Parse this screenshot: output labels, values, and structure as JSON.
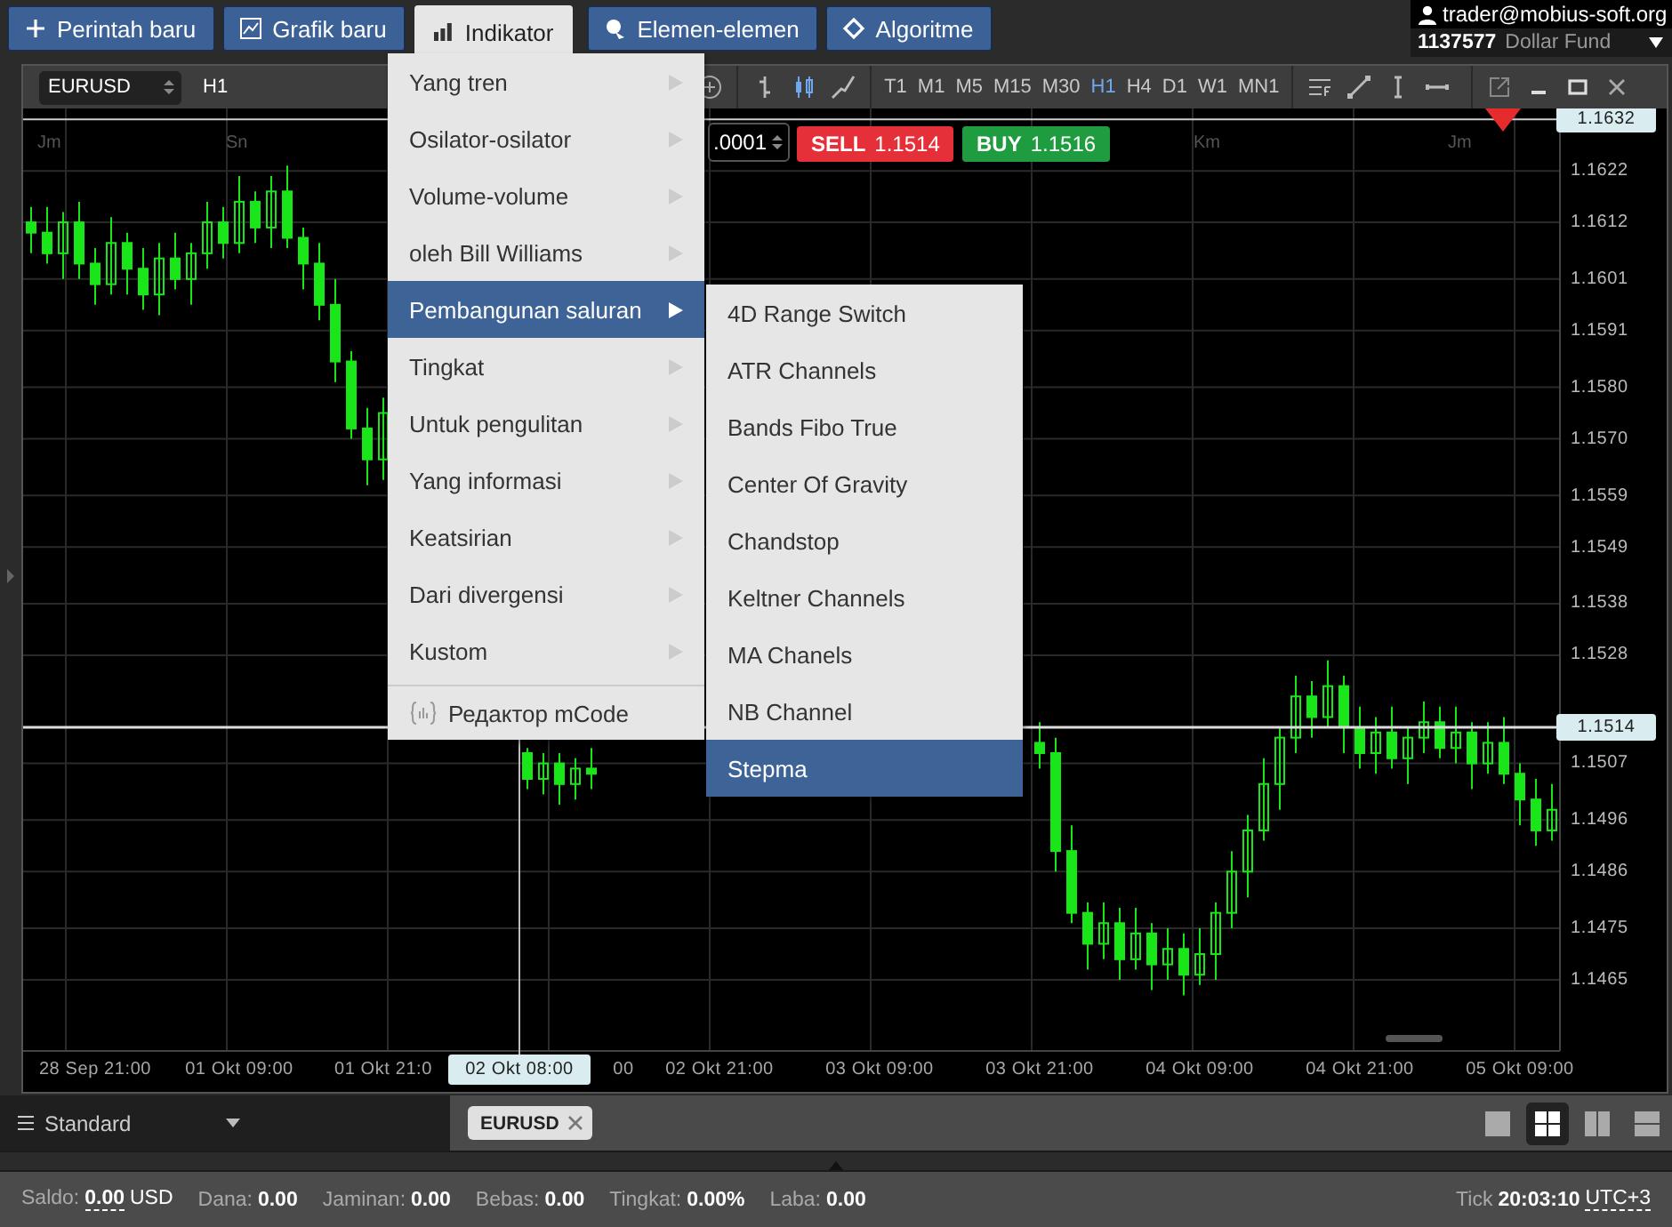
{
  "top_menu": [
    {
      "label": "Perintah baru",
      "selected": false
    },
    {
      "label": "Grafik baru",
      "selected": false
    },
    {
      "label": "Indikator",
      "selected": true
    },
    {
      "label": "Elemen-elemen",
      "selected": false
    },
    {
      "label": "Algoritme",
      "selected": false
    }
  ],
  "account": {
    "email": "trader@mobius-soft.org",
    "number": "1137577",
    "name": "Dollar Fund"
  },
  "chart": {
    "symbol": "EURUSD",
    "period": "H1",
    "lot": ".0001",
    "sell": {
      "label": "SELL",
      "price": "1.1514"
    },
    "buy": {
      "label": "BUY",
      "price": "1.1516"
    },
    "timeframes": [
      {
        "label": "T1",
        "selected": false
      },
      {
        "label": "M1",
        "selected": false
      },
      {
        "label": "M5",
        "selected": false
      },
      {
        "label": "M15",
        "selected": false
      },
      {
        "label": "M30",
        "selected": false
      },
      {
        "label": "H1",
        "selected": true
      },
      {
        "label": "H4",
        "selected": false
      },
      {
        "label": "D1",
        "selected": false
      },
      {
        "label": "W1",
        "selected": false
      },
      {
        "label": "MN1",
        "selected": false
      }
    ],
    "day_labels": [
      "Jm",
      "Sn",
      "Km",
      "Jm"
    ],
    "chart_data": {
      "type": "candlestick",
      "categories": [
        null,
        null,
        null,
        null,
        "28 Sep 21:00",
        null,
        null,
        null,
        null,
        null,
        null,
        null,
        null,
        "01 Okt 09:00",
        null,
        null,
        null,
        null,
        null,
        null,
        null,
        null,
        "01 Okt 21:0",
        null,
        null,
        null,
        null,
        null,
        null,
        null,
        null,
        null,
        null,
        null,
        null,
        null,
        null,
        "00",
        null,
        null,
        null,
        null,
        null,
        "02 Okt 21:00",
        null,
        null,
        null,
        null,
        null,
        null,
        null,
        null,
        null,
        "03 Okt 09:00",
        null,
        null,
        null,
        null,
        null,
        null,
        null,
        null,
        null,
        "03 Okt 21:00",
        null,
        null,
        null,
        null,
        null,
        null,
        null,
        null,
        null,
        "04 Okt 09:00",
        null,
        null,
        null,
        null,
        null,
        null,
        null,
        null,
        null,
        "04 Okt 21:00",
        null,
        null,
        null,
        null,
        null,
        null,
        null,
        null,
        null,
        "05 Okt 09:00",
        null,
        null
      ],
      "ohlc": [
        [
          1.1612,
          1.1615,
          1.1606,
          1.161
        ],
        [
          1.161,
          1.1615,
          1.1604,
          1.1606
        ],
        [
          1.1606,
          1.1614,
          1.1601,
          1.1612
        ],
        [
          1.1612,
          1.1616,
          1.1601,
          1.1604
        ],
        [
          1.1604,
          1.1607,
          1.1596,
          1.16
        ],
        [
          1.16,
          1.1613,
          1.1598,
          1.1608
        ],
        [
          1.1608,
          1.161,
          1.1598,
          1.1603
        ],
        [
          1.1603,
          1.1607,
          1.1595,
          1.1598
        ],
        [
          1.1598,
          1.1608,
          1.1594,
          1.1605
        ],
        [
          1.1605,
          1.161,
          1.1599,
          1.1601
        ],
        [
          1.1601,
          1.1608,
          1.1596,
          1.1606
        ],
        [
          1.1606,
          1.1616,
          1.1603,
          1.1612
        ],
        [
          1.1612,
          1.1615,
          1.1605,
          1.1608
        ],
        [
          1.1608,
          1.1621,
          1.1606,
          1.1616
        ],
        [
          1.1616,
          1.1618,
          1.1608,
          1.1611
        ],
        [
          1.1611,
          1.1621,
          1.1607,
          1.1618
        ],
        [
          1.1618,
          1.1623,
          1.1607,
          1.1609
        ],
        [
          1.1609,
          1.1611,
          1.1599,
          1.1604
        ],
        [
          1.1604,
          1.1608,
          1.1593,
          1.1596
        ],
        [
          1.1596,
          1.1601,
          1.1581,
          1.1585
        ],
        [
          1.1585,
          1.1587,
          1.157,
          1.1572
        ],
        [
          1.1572,
          1.1576,
          1.1561,
          1.1566
        ],
        [
          1.1566,
          1.1578,
          1.1562,
          1.1575
        ],
        null,
        null,
        null,
        null,
        null,
        null,
        null,
        null,
        [
          1.1509,
          1.151,
          1.1502,
          1.1504
        ],
        [
          1.1504,
          1.1509,
          1.1501,
          1.1507
        ],
        [
          1.1507,
          1.1509,
          1.1499,
          1.1503
        ],
        [
          1.1503,
          1.1508,
          1.15,
          1.1506
        ],
        [
          1.1506,
          1.151,
          1.1502,
          1.1505
        ],
        null,
        null,
        null,
        null,
        null,
        null,
        null,
        null,
        null,
        null,
        null,
        null,
        null,
        null,
        null,
        null,
        null,
        null,
        null,
        null,
        null,
        null,
        null,
        null,
        null,
        null,
        null,
        [
          1.1511,
          1.1515,
          1.1506,
          1.1509
        ],
        [
          1.1509,
          1.1512,
          1.1486,
          1.149
        ],
        [
          1.149,
          1.1495,
          1.1476,
          1.1478
        ],
        [
          1.1478,
          1.148,
          1.1467,
          1.1472
        ],
        [
          1.1472,
          1.148,
          1.1469,
          1.1476
        ],
        [
          1.1476,
          1.1479,
          1.1465,
          1.1469
        ],
        [
          1.1469,
          1.1479,
          1.1467,
          1.1474
        ],
        [
          1.1474,
          1.1476,
          1.1463,
          1.1468
        ],
        [
          1.1468,
          1.1475,
          1.1465,
          1.1471
        ],
        [
          1.1471,
          1.1474,
          1.1462,
          1.1466
        ],
        [
          1.1466,
          1.1475,
          1.1464,
          1.147
        ],
        [
          1.147,
          1.148,
          1.1465,
          1.1478
        ],
        [
          1.1478,
          1.149,
          1.1475,
          1.1486
        ],
        [
          1.1486,
          1.1497,
          1.1481,
          1.1494
        ],
        [
          1.1494,
          1.1508,
          1.1492,
          1.1503
        ],
        [
          1.1503,
          1.1514,
          1.1498,
          1.1512
        ],
        [
          1.1512,
          1.1524,
          1.1509,
          1.152
        ],
        [
          1.152,
          1.1523,
          1.1512,
          1.1516
        ],
        [
          1.1516,
          1.1527,
          1.1514,
          1.1522
        ],
        [
          1.1522,
          1.1524,
          1.1509,
          1.1514
        ],
        [
          1.1514,
          1.1518,
          1.1506,
          1.1509
        ],
        [
          1.1509,
          1.1516,
          1.1505,
          1.1513
        ],
        [
          1.1513,
          1.1518,
          1.1506,
          1.1508
        ],
        [
          1.1508,
          1.1514,
          1.1503,
          1.1512
        ],
        [
          1.1512,
          1.1519,
          1.1509,
          1.1515
        ],
        [
          1.1515,
          1.1518,
          1.1508,
          1.151
        ],
        [
          1.151,
          1.1518,
          1.1507,
          1.1513
        ],
        [
          1.1513,
          1.1515,
          1.1502,
          1.1507
        ],
        [
          1.1507,
          1.1515,
          1.1505,
          1.1511
        ],
        [
          1.1511,
          1.1516,
          1.1503,
          1.1505
        ],
        [
          1.1505,
          1.1507,
          1.1495,
          1.15
        ],
        [
          1.15,
          1.1504,
          1.1491,
          1.1494
        ],
        [
          1.1494,
          1.1503,
          1.1492,
          1.1498
        ]
      ],
      "ylim": [
        1.14512,
        1.16341
      ],
      "annotations": [
        "02 Okt 08:00"
      ],
      "grid": true,
      "ref_lines": [
        {
          "axis": "y",
          "value": 1.1632,
          "label": "1.1632"
        },
        {
          "axis": "y",
          "value": 1.1514,
          "label": "1.1514"
        }
      ],
      "yticks": [
        {
          "value": 1.1622,
          "label": "1.1622"
        },
        {
          "value": 1.1612,
          "label": "1.1612"
        },
        {
          "value": 1.1601,
          "label": "1.1601"
        },
        {
          "value": 1.1591,
          "label": "1.1591"
        },
        {
          "value": 1.158,
          "label": "1.1580"
        },
        {
          "value": 1.157,
          "label": "1.1570"
        },
        {
          "value": 1.1559,
          "label": "1.1559"
        },
        {
          "value": 1.1549,
          "label": "1.1549"
        },
        {
          "value": 1.1538,
          "label": "1.1538"
        },
        {
          "value": 1.1528,
          "label": "1.1528"
        },
        {
          "value": 1.1507,
          "label": "1.1507"
        },
        {
          "value": 1.1496,
          "label": "1.1496"
        },
        {
          "value": 1.1486,
          "label": "1.1486"
        },
        {
          "value": 1.1475,
          "label": "1.1475"
        },
        {
          "value": 1.1465,
          "label": "1.1465"
        }
      ]
    }
  },
  "indicator_menu": {
    "items": [
      {
        "label": "Yang tren",
        "selected": false
      },
      {
        "label": "Osilator-osilator",
        "selected": false
      },
      {
        "label": "Volume-volume",
        "selected": false
      },
      {
        "label": "oleh Bill Williams",
        "selected": false
      },
      {
        "label": "Pembangunan saluran",
        "selected": true
      },
      {
        "label": "Tingkat",
        "selected": false
      },
      {
        "label": "Untuk pengulitan",
        "selected": false
      },
      {
        "label": "Yang informasi",
        "selected": false
      },
      {
        "label": "Keatsirian",
        "selected": false
      },
      {
        "label": "Dari divergensi",
        "selected": false
      },
      {
        "label": "Kustom",
        "selected": false
      }
    ],
    "editor": "Редактор mCode"
  },
  "submenu": {
    "items": [
      {
        "label": "4D Range Switch",
        "selected": false
      },
      {
        "label": "ATR Channels",
        "selected": false
      },
      {
        "label": "Bands Fibo True",
        "selected": false
      },
      {
        "label": "Center Of Gravity",
        "selected": false
      },
      {
        "label": "Chandstop",
        "selected": false
      },
      {
        "label": "Keltner Channels",
        "selected": false
      },
      {
        "label": "MA Chanels",
        "selected": false
      },
      {
        "label": "NB Channel",
        "selected": false
      },
      {
        "label": "Stepma",
        "selected": true
      }
    ]
  },
  "bottom": {
    "workspace": "Standard",
    "tabs": [
      {
        "label": "EURUSD"
      }
    ],
    "layouts": [
      {
        "selected": false
      },
      {
        "selected": true
      },
      {
        "selected": false
      },
      {
        "selected": false
      }
    ]
  },
  "status": {
    "fields": [
      {
        "label": "Saldo:",
        "value": "0.00",
        "unit": "USD"
      },
      {
        "label": "Dana:",
        "value": "0.00"
      },
      {
        "label": "Jaminan:",
        "value": "0.00"
      },
      {
        "label": "Bebas:",
        "value": "0.00"
      },
      {
        "label": "Tingkat:",
        "value": "0.00%"
      },
      {
        "label": "Laba:",
        "value": "0.00"
      }
    ],
    "tick_label": "Tick",
    "tick_time": "20:03:10",
    "timezone": "UTC+3"
  }
}
